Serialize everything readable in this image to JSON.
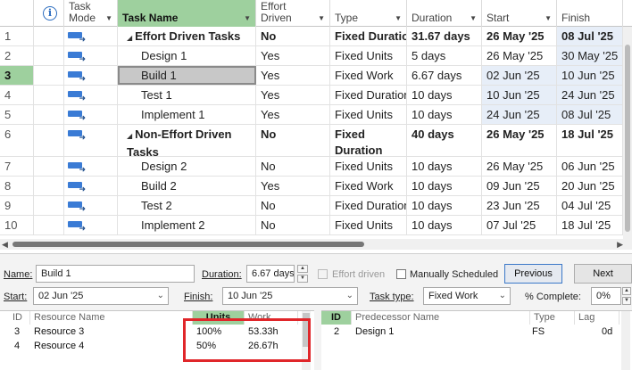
{
  "grid": {
    "columns": {
      "task_mode": "Task Mode",
      "task_name": "Task Name",
      "effort_driven": "Effort Driven",
      "type": "Type",
      "duration": "Duration",
      "start": "Start",
      "finish": "Finish"
    },
    "rows": [
      {
        "id": "1",
        "name": "Effort Driven Tasks",
        "summary": true,
        "effort": "No",
        "type": "Fixed Duration",
        "duration": "31.67 days",
        "start": "26 May '25",
        "finish": "08 Jul '25"
      },
      {
        "id": "2",
        "name": "Design 1",
        "summary": false,
        "effort": "Yes",
        "type": "Fixed Units",
        "duration": "5 days",
        "start": "26 May '25",
        "finish": "30 May '25"
      },
      {
        "id": "3",
        "name": "Build 1",
        "summary": false,
        "effort": "Yes",
        "type": "Fixed Work",
        "duration": "6.67 days",
        "start": "02 Jun '25",
        "finish": "10 Jun '25"
      },
      {
        "id": "4",
        "name": "Test 1",
        "summary": false,
        "effort": "Yes",
        "type": "Fixed Duration",
        "duration": "10 days",
        "start": "10 Jun '25",
        "finish": "24 Jun '25"
      },
      {
        "id": "5",
        "name": "Implement 1",
        "summary": false,
        "effort": "Yes",
        "type": "Fixed Units",
        "duration": "10 days",
        "start": "24 Jun '25",
        "finish": "08 Jul '25"
      },
      {
        "id": "6",
        "name": "Non-Effort Driven Tasks",
        "summary": true,
        "effort": "No",
        "type": "Fixed Duration",
        "duration": "40 days",
        "start": "26 May '25",
        "finish": "18 Jul '25"
      },
      {
        "id": "7",
        "name": "Design 2",
        "summary": false,
        "effort": "No",
        "type": "Fixed Units",
        "duration": "10 days",
        "start": "26 May '25",
        "finish": "06 Jun '25"
      },
      {
        "id": "8",
        "name": "Build 2",
        "summary": false,
        "effort": "Yes",
        "type": "Fixed Work",
        "duration": "10 days",
        "start": "09 Jun '25",
        "finish": "20 Jun '25"
      },
      {
        "id": "9",
        "name": "Test 2",
        "summary": false,
        "effort": "No",
        "type": "Fixed Duration",
        "duration": "10 days",
        "start": "23 Jun '25",
        "finish": "04 Jul '25"
      },
      {
        "id": "10",
        "name": "Implement 2",
        "summary": false,
        "effort": "No",
        "type": "Fixed Units",
        "duration": "10 days",
        "start": "07 Jul '25",
        "finish": "18 Jul '25"
      }
    ]
  },
  "form": {
    "name_label": "Name:",
    "name_value": "Build 1",
    "duration_label": "Duration:",
    "duration_value": "6.67 days",
    "effort_driven_label": "Effort driven",
    "manually_scheduled_label": "Manually Scheduled",
    "previous_label": "Previous",
    "next_label": "Next",
    "start_label": "Start:",
    "start_value": "02 Jun '25",
    "finish_label": "Finish:",
    "finish_value": "10 Jun '25",
    "task_type_label": "Task type:",
    "task_type_value": "Fixed Work",
    "complete_label": "% Complete:",
    "complete_value": "0%"
  },
  "resources": {
    "headers": {
      "id": "ID",
      "name": "Resource Name",
      "units": "Units",
      "work": "Work"
    },
    "rows": [
      {
        "id": "3",
        "name": "Resource 3",
        "units": "100%",
        "work": "53.33h"
      },
      {
        "id": "4",
        "name": "Resource 4",
        "units": "50%",
        "work": "26.67h"
      }
    ]
  },
  "predecessors": {
    "headers": {
      "id": "ID",
      "name": "Predecessor Name",
      "type": "Type",
      "lag": "Lag"
    },
    "rows": [
      {
        "id": "2",
        "name": "Design 1",
        "type": "FS",
        "lag": "0d"
      }
    ]
  },
  "colors": {
    "selection_green": "#9ed09e",
    "highlight_box": "#e0262a",
    "mode_icon": "#3a7bd5"
  }
}
